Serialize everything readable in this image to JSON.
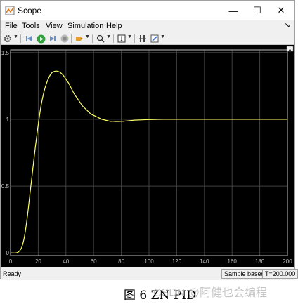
{
  "window": {
    "title": "Scope",
    "minimize_glyph": "—",
    "maximize_glyph": "☐",
    "close_glyph": "✕"
  },
  "menu": [
    {
      "label": "File"
    },
    {
      "label": "Tools"
    },
    {
      "label": "View"
    },
    {
      "label": "Simulation"
    },
    {
      "label": "Help"
    }
  ],
  "menu_overflow_glyph": "↘",
  "toolbar_icons": [
    "gear-icon",
    "dropdown-arrow-icon",
    "step-back-icon",
    "run-icon",
    "step-forward-icon",
    "stop-icon",
    "highlight-icon",
    "dropdown-arrow-icon",
    "zoom-icon",
    "dropdown-arrow-icon",
    "scale-axes-icon",
    "dropdown-arrow-icon",
    "cursor-measurements-icon",
    "style-icon",
    "dropdown-arrow-icon"
  ],
  "plot": {
    "background": "#000000",
    "grid_color": "#404040",
    "axis_color": "#bfbfbf",
    "line_color": "#ffff66",
    "corner_button_glyph": "▴"
  },
  "status": {
    "left": "Ready",
    "mode": "Sample based",
    "time": "T=200.000"
  },
  "caption": "图 6 ZN-PID",
  "watermark": "CSDN @阿健也会编程",
  "chart_data": {
    "type": "line",
    "title": "",
    "xlabel": "",
    "ylabel": "",
    "xlim": [
      0,
      200
    ],
    "ylim": [
      -0.02,
      1.52
    ],
    "xticks": [
      "0",
      "20",
      "40",
      "60",
      "80",
      "100",
      "120",
      "140",
      "160",
      "180",
      "200"
    ],
    "yticks": [
      "0",
      "0.5",
      "1",
      "1.5"
    ],
    "grid": true,
    "series": [
      {
        "name": "",
        "x": [
          0,
          4,
          6,
          8,
          10,
          12,
          14,
          16,
          18,
          20,
          22,
          24,
          26,
          28,
          30,
          32,
          34,
          36,
          38,
          40,
          42,
          44,
          46,
          48,
          50,
          52,
          54,
          56,
          58,
          60,
          62,
          64,
          66,
          68,
          70,
          72,
          74,
          76,
          78,
          80,
          82,
          84,
          86,
          88,
          90,
          95,
          100,
          105,
          110,
          115,
          120,
          130,
          140,
          150,
          160,
          170,
          180,
          190,
          200
        ],
        "y": [
          0,
          0,
          0.01,
          0.04,
          0.12,
          0.26,
          0.44,
          0.62,
          0.8,
          0.96,
          1.1,
          1.2,
          1.27,
          1.32,
          1.35,
          1.36,
          1.36,
          1.35,
          1.33,
          1.3,
          1.27,
          1.23,
          1.19,
          1.16,
          1.13,
          1.1,
          1.08,
          1.06,
          1.04,
          1.03,
          1.02,
          1.01,
          1.0,
          0.995,
          0.99,
          0.985,
          0.985,
          0.984,
          0.984,
          0.985,
          0.986,
          0.988,
          0.99,
          0.992,
          0.994,
          0.996,
          0.998,
          0.999,
          1.0,
          1.0,
          1.0,
          1.0,
          1.0,
          1.0,
          1.0,
          1.0,
          1.0,
          1.0,
          1.0
        ]
      }
    ]
  }
}
